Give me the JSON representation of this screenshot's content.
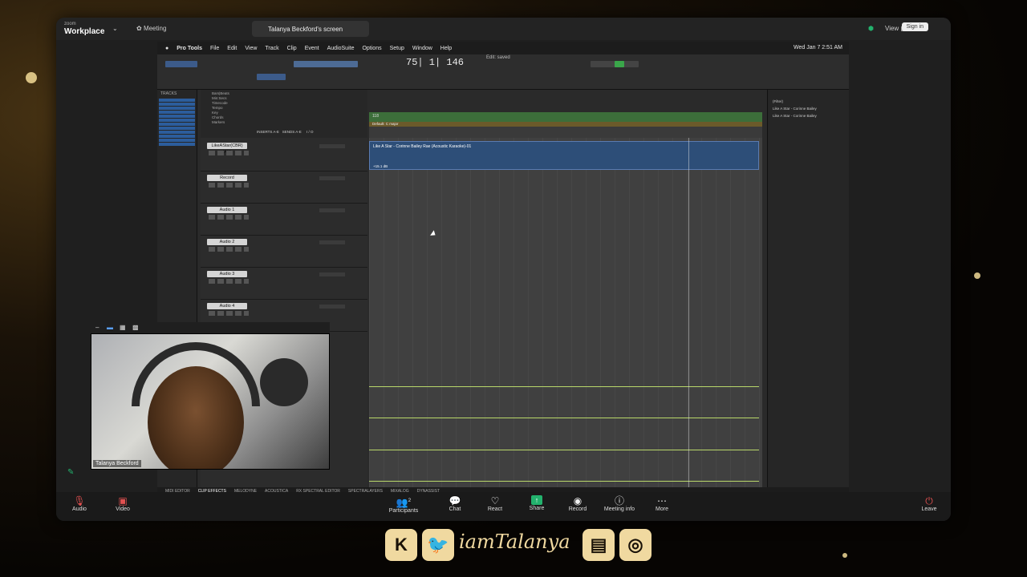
{
  "zoom": {
    "brand_small": "zoom",
    "brand_big": "Workplace",
    "meeting_tab": "Meeting",
    "share_tab": "Talanya Beckford's screen",
    "view_label": "View",
    "signin_label": "Sign in"
  },
  "mac": {
    "app_name": "Pro Tools",
    "menus": [
      "File",
      "Edit",
      "View",
      "Track",
      "Clip",
      "Event",
      "AudioSuite",
      "Options",
      "Setup",
      "Window",
      "Help"
    ],
    "clock": "Wed Jan 7  2:51 AM"
  },
  "protools": {
    "edit_title": "Edit: saved",
    "counter": "75| 1| 146",
    "tracks_header": "TRACKS",
    "ruler_rows": [
      "Bars|Beats",
      "Min:Secs",
      "Timecode",
      "Tempo",
      "Key",
      "Chords",
      "Markers"
    ],
    "marker_label": "118",
    "key_label": "Default: C major",
    "column_headers": [
      "INSERTS A-E",
      "SENDS A-E",
      "I / O"
    ],
    "tracks": [
      {
        "name": "LikeAStar(CBR)(AK)"
      },
      {
        "name": "Record"
      },
      {
        "name": "Audio 1"
      },
      {
        "name": "Audio 2"
      },
      {
        "name": "Audio 3"
      },
      {
        "name": "Audio 4"
      }
    ],
    "clip_title": "Like A Star - Corinne Bailey Rae (Acoustic Karaoke)-01",
    "clip_gain": "+15.1 dB",
    "cliplist_filter": "(Filter)",
    "cliplist_entries": [
      "Like A Star - Corinne Bailey",
      "Like A Star - Corinne Bailey"
    ],
    "bottom_tabs": [
      "MIDI EDITOR",
      "CLIP EFFECTS",
      "MELODYNE",
      "ACOUSTICA",
      "RX SPECTRAL EDITOR",
      "SPECTRALAYERS",
      "MIXALOG",
      "DYNASSIST"
    ]
  },
  "webcam": {
    "name": "Talanya Beckford"
  },
  "controls": {
    "audio": "Audio",
    "video": "Video",
    "participants": "Participants",
    "participants_count": "2",
    "chat": "Chat",
    "react": "React",
    "share": "Share",
    "record": "Record",
    "meeting_info": "Meeting info",
    "more": "More",
    "leave": "Leave"
  },
  "social": {
    "handle": "iamTalanya",
    "icons": [
      "kick-icon",
      "twitter-icon",
      "twitch-icon",
      "instagram-icon"
    ]
  },
  "colors": {
    "accent_green": "#23b26d",
    "gold": "#f0d9a0",
    "clip_blue": "#2d4e78"
  }
}
